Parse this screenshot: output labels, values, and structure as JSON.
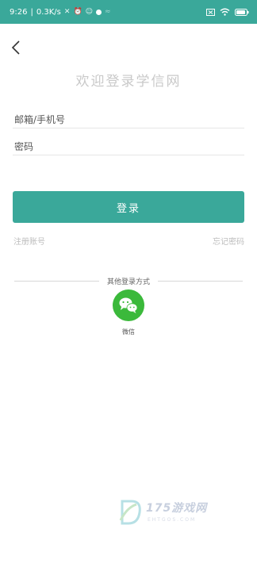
{
  "status_bar": {
    "time": "9:26",
    "speed": "0.3K/s",
    "icons": [
      "mute-icon",
      "alarm-icon",
      "app-icon",
      "circle-icon",
      "signal-icon",
      "close-box-icon",
      "wifi-icon",
      "battery-icon"
    ]
  },
  "header": {
    "back_icon": "chevron-left-icon",
    "title": "欢迎登录学信网"
  },
  "form": {
    "username_placeholder": "邮箱/手机号",
    "password_placeholder": "密码",
    "login_label": "登录"
  },
  "links": {
    "register": "注册账号",
    "forgot": "忘记密码"
  },
  "other_login": {
    "divider_text": "其他登录方式",
    "wechat_label": "微信"
  },
  "watermark": {
    "main": "175游戏网",
    "sub": "EHTGOS.COM"
  },
  "colors": {
    "accent": "#3aa89a",
    "wechat": "#3bb93b"
  }
}
